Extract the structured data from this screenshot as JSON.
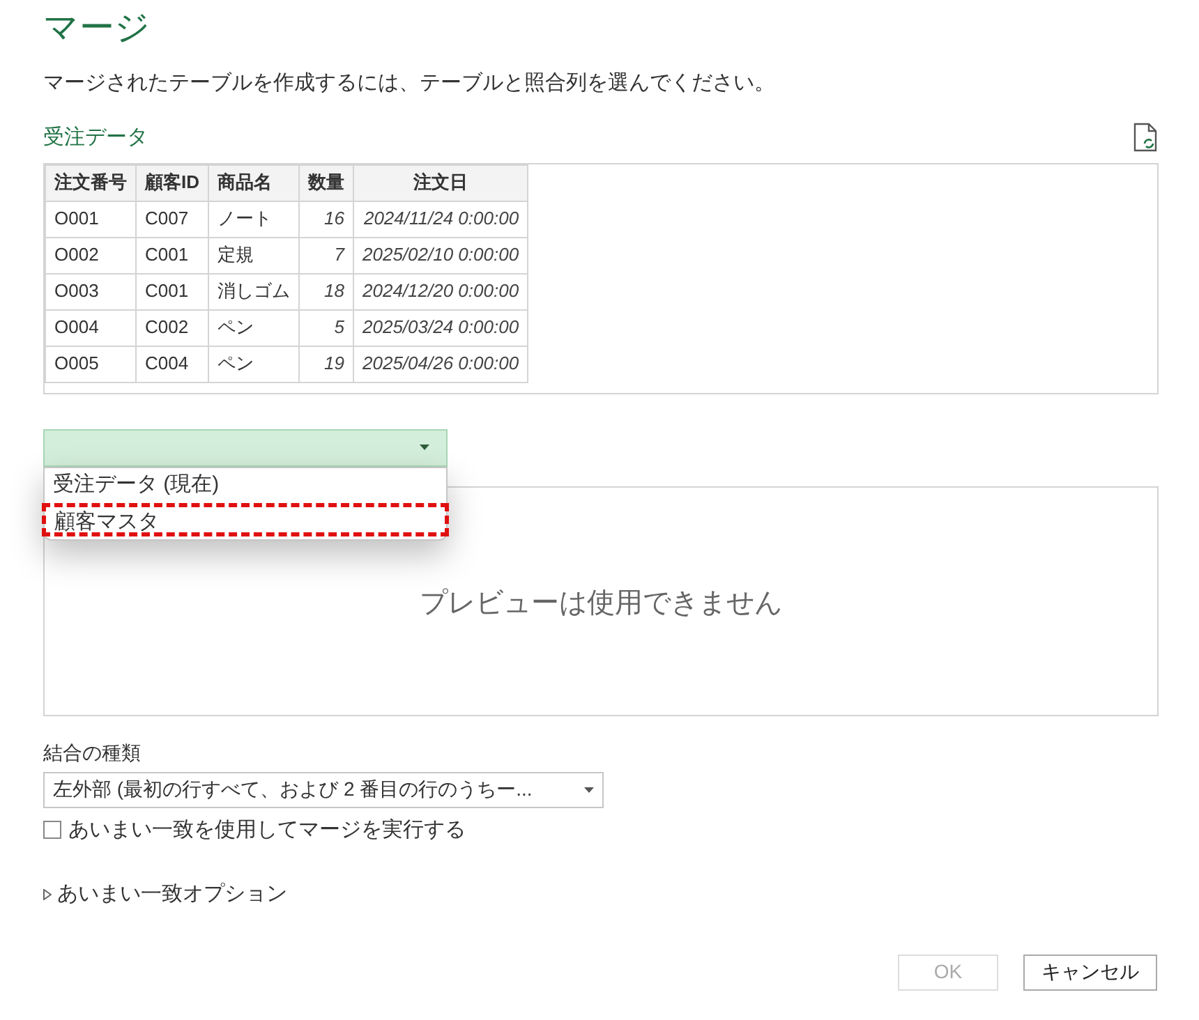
{
  "title": "マージ",
  "description": "マージされたテーブルを作成するには、テーブルと照合列を選んでください。",
  "table_name": "受注データ",
  "table": {
    "columns": [
      {
        "label": "注文番号",
        "kind": "text"
      },
      {
        "label": "顧客ID",
        "kind": "text"
      },
      {
        "label": "商品名",
        "kind": "text"
      },
      {
        "label": "数量",
        "kind": "number"
      },
      {
        "label": "注文日",
        "kind": "date"
      }
    ],
    "rows": [
      [
        "O001",
        "C007",
        "ノート",
        "16",
        "2024/11/24 0:00:00"
      ],
      [
        "O002",
        "C001",
        "定規",
        "7",
        "2025/02/10 0:00:00"
      ],
      [
        "O003",
        "C001",
        "消しゴム",
        "18",
        "2024/12/20 0:00:00"
      ],
      [
        "O004",
        "C002",
        "ペン",
        "5",
        "2025/03/24 0:00:00"
      ],
      [
        "O005",
        "C004",
        "ペン",
        "19",
        "2025/04/26 0:00:00"
      ]
    ]
  },
  "second_table_dropdown": {
    "expanded": true,
    "options": [
      {
        "label": "受注データ (現在)",
        "selected": false
      },
      {
        "label": "顧客マスタ",
        "selected": true
      }
    ]
  },
  "preview_message": "プレビューは使用できません",
  "join_kind_label": "結合の種類",
  "join_kind_value": "左外部 (最初の行すべて、および 2 番目の行のうちー...",
  "fuzzy_checkbox": {
    "label": "あいまい一致を使用してマージを実行する",
    "checked": false
  },
  "fuzzy_options": {
    "label": "あいまい一致オプション",
    "expanded": false
  },
  "buttons": [
    {
      "label": "OK",
      "disabled": true
    },
    {
      "label": "キャンセル",
      "disabled": false
    }
  ]
}
